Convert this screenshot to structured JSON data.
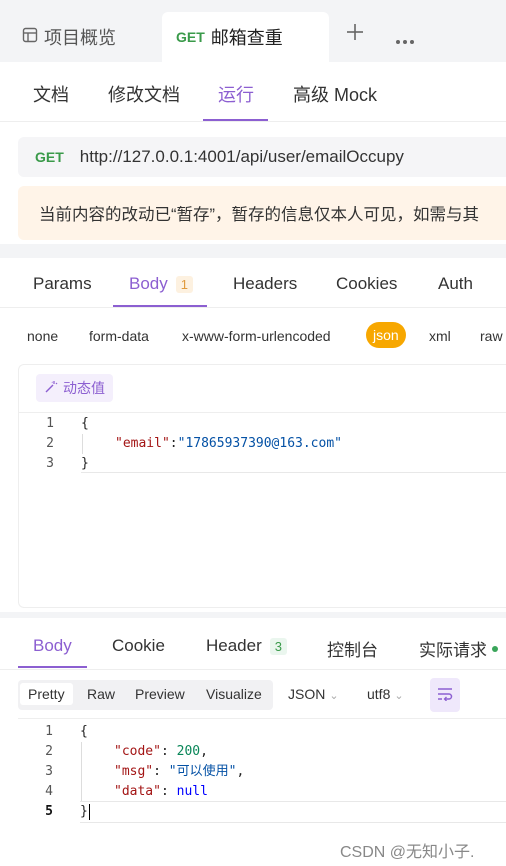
{
  "top_tabs": {
    "overview_label": "项目概览",
    "active_method": "GET",
    "active_title": "邮箱查重",
    "add_icon": "plus-icon",
    "more_icon": "more-icon"
  },
  "doc_tabs": [
    "文档",
    "修改文档",
    "运行",
    "高级 Mock"
  ],
  "url_bar": {
    "method": "GET",
    "url": "http://127.0.0.1:4001/api/user/emailOccupy"
  },
  "notice": "当前内容的改动已“暂存”，暂存的信息仅本人可见，如需与其",
  "request_tabs": {
    "params": "Params",
    "body": "Body",
    "body_count": "1",
    "headers": "Headers",
    "cookies": "Cookies",
    "auth": "Auth"
  },
  "body_types": [
    "none",
    "form-data",
    "x-www-form-urlencoded",
    "json",
    "xml",
    "raw"
  ],
  "dynamic_value_label": "动态值",
  "request_body": {
    "line_numbers": [
      "1",
      "2",
      "3"
    ],
    "open": "{",
    "key": "\"email\"",
    "colon": ":",
    "value": "\"17865937390@163.com\"",
    "close": "}"
  },
  "response_tabs": {
    "body": "Body",
    "cookie": "Cookie",
    "header": "Header",
    "header_count": "3",
    "console": "控制台",
    "actual_request": "实际请求"
  },
  "response_toolbar": {
    "modes": [
      "Pretty",
      "Raw",
      "Preview",
      "Visualize"
    ],
    "format": "JSON",
    "encoding": "utf8"
  },
  "response_body": {
    "line_numbers": [
      "1",
      "2",
      "3",
      "4",
      "5"
    ],
    "open": "{",
    "code_key": "\"code\"",
    "code_value": "200",
    "msg_key": "\"msg\"",
    "msg_value": "\"可以使用\"",
    "data_key": "\"data\"",
    "data_value": "null",
    "close": "}"
  },
  "watermark": "CSDN @无知小子."
}
